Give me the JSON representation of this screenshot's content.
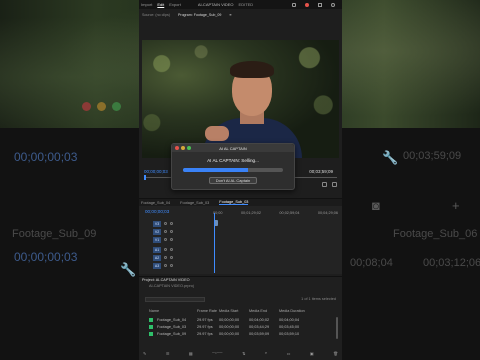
{
  "menu": {
    "items": [
      "Import",
      "Edit",
      "Export"
    ],
    "active": "Edit",
    "project_title": "AI-CAPTAIN VIDEO",
    "tag": "EDITED"
  },
  "panel_tabs": {
    "source": "Source: (no clips)",
    "program": "Program: Footage_Sub_09",
    "program_menu": "≡"
  },
  "monitor": {
    "timecode_left": "00;00;00;03",
    "timecode_right": "00;03;59;09"
  },
  "dialog": {
    "title": "AI AL CAPTAIN",
    "message": "AI AL CAPTAIN: Selling...",
    "progress": 0.65,
    "button": "Don't AI AL Captain"
  },
  "timeline": {
    "tabs": [
      "Footage_Sub_04",
      "Footage_Sub_03",
      "Footage_Sub_03"
    ],
    "active_tab": "Footage_Sub_03",
    "timecode": "00;00;00;03",
    "ruler": [
      "00;00",
      "00;01;29;02",
      "00;02;59;04",
      "00;04;29;06"
    ],
    "video_tracks": [
      "V3",
      "V2",
      "V1"
    ],
    "audio_tracks": [
      "A1",
      "A2",
      "A3"
    ]
  },
  "project": {
    "title": "Project: AI-CAPTAIN VIDEO",
    "path": "AI-CAPTAIN VIDEO.prproj",
    "item_count": "1 of 1 items selected",
    "columns": [
      "Name",
      "Frame Rate",
      "Media Start",
      "Media End",
      "Media Duration"
    ],
    "rows": [
      {
        "name": "Footage_Sub_04",
        "fps": "29.97 fps",
        "start": "00;00;00;00",
        "end": "00;04;00;02",
        "dur": "00;04;00;04"
      },
      {
        "name": "Footage_Sub_03",
        "fps": "29.97 fps",
        "start": "00;00;00;00",
        "end": "00;03;44;29",
        "dur": "00;03;45;00"
      },
      {
        "name": "Footage_Sub_09",
        "fps": "29.97 fps",
        "start": "00;00;00;00",
        "end": "00;03;59;09",
        "dur": "00;03;59;10"
      }
    ]
  },
  "background": {
    "tc_left_large": "00;00;00;03",
    "tc_right_large": "00;03;59;09",
    "tab_left": "Footage_Sub_09",
    "tab_right": "Footage_Sub_06",
    "ruler_right": "00;03;12;06",
    "ruler_mid": "00;08;04"
  },
  "colors": {
    "accent": "#3f8cff",
    "progress": "#3a82f6",
    "traffic_red": "#e5534b",
    "traffic_yellow": "#d6a93a",
    "traffic_green": "#4bbf55",
    "label_green": "#2fbf6a"
  }
}
